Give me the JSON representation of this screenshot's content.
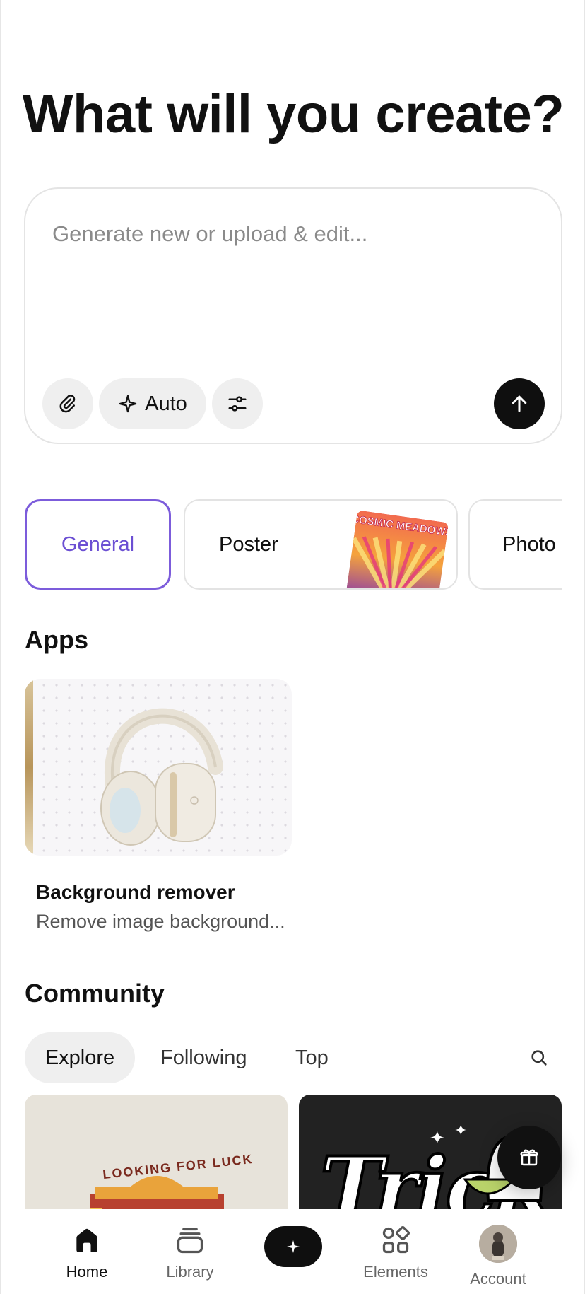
{
  "header": {
    "title": "What will you create?"
  },
  "prompt": {
    "placeholder": "Generate new or upload & edit...",
    "mode_label": "Auto"
  },
  "styles": [
    {
      "label": "General",
      "selected": true
    },
    {
      "label": "Poster",
      "thumb_text": "COSMIC MEADOWS"
    },
    {
      "label": "Photo"
    }
  ],
  "apps": {
    "title": "Apps",
    "items": [
      {
        "title": "Background remover",
        "subtitle": "Remove image background..."
      }
    ]
  },
  "community": {
    "title": "Community",
    "tabs": [
      {
        "label": "Explore",
        "active": true
      },
      {
        "label": "Following"
      },
      {
        "label": "Top"
      }
    ],
    "cards": [
      {
        "text": "LOOKING FOR LUCK"
      },
      {
        "text": "Trick"
      }
    ]
  },
  "nav": {
    "items": [
      {
        "label": "Home",
        "active": true,
        "icon": "home-icon"
      },
      {
        "label": "Library",
        "icon": "library-icon"
      },
      {
        "label": "Elements",
        "icon": "elements-icon"
      },
      {
        "label": "Account",
        "icon": "avatar"
      }
    ]
  },
  "colors": {
    "accent": "#7c5cdb",
    "primary": "#0f0f0f",
    "pill_bg": "#efefef"
  }
}
